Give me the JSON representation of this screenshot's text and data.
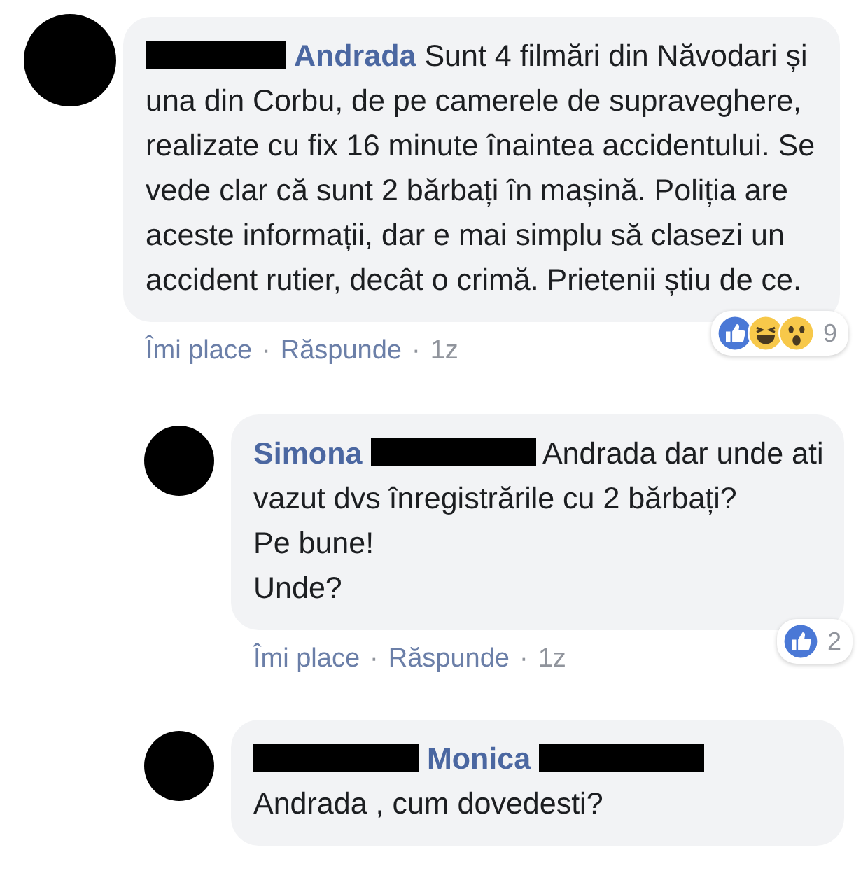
{
  "comments": [
    {
      "head": [
        {
          "kind": "redaction"
        },
        {
          "kind": "name",
          "text": "Andrada"
        }
      ],
      "text": "Sunt 4 filmări din Năvodari și una din Corbu, de pe camerele de supraveghere, realizate cu fix 16 minute înaintea accidentului. Se vede clar că sunt 2 bărbați în mașină. Poliția are aceste informații, dar e mai simplu să clasezi un accident rutier, decât o crimă. Prietenii știu de ce.",
      "reactions": {
        "icons": [
          {
            "kind": "like"
          },
          {
            "kind": "haha"
          },
          {
            "kind": "wow"
          }
        ],
        "count": "9"
      },
      "actions": [
        {
          "kind": "link",
          "text": "Îmi place"
        },
        {
          "kind": "separator",
          "text": "·"
        },
        {
          "kind": "link",
          "text": "Răspunde"
        },
        {
          "kind": "separator",
          "text": "·"
        },
        {
          "kind": "time",
          "text": "1z"
        }
      ],
      "replies": [
        {
          "head": [
            {
              "kind": "name",
              "text": "Simona"
            },
            {
              "kind": "redaction"
            }
          ],
          "text": "Andrada dar unde ati vazut dvs înregistrările cu 2 bărbați?\nPe bune!\nUnde?",
          "reactions": {
            "icons": [
              {
                "kind": "like"
              }
            ],
            "count": "2"
          },
          "actions": [
            {
              "kind": "link",
              "text": "Îmi place"
            },
            {
              "kind": "separator",
              "text": "·"
            },
            {
              "kind": "link",
              "text": "Răspunde"
            },
            {
              "kind": "separator",
              "text": "·"
            },
            {
              "kind": "time",
              "text": "1z"
            }
          ]
        },
        {
          "head": [
            {
              "kind": "redaction"
            },
            {
              "kind": "name",
              "text": "Monica"
            },
            {
              "kind": "redaction"
            }
          ],
          "text": "Andrada , cum dovedesti?"
        }
      ]
    }
  ]
}
